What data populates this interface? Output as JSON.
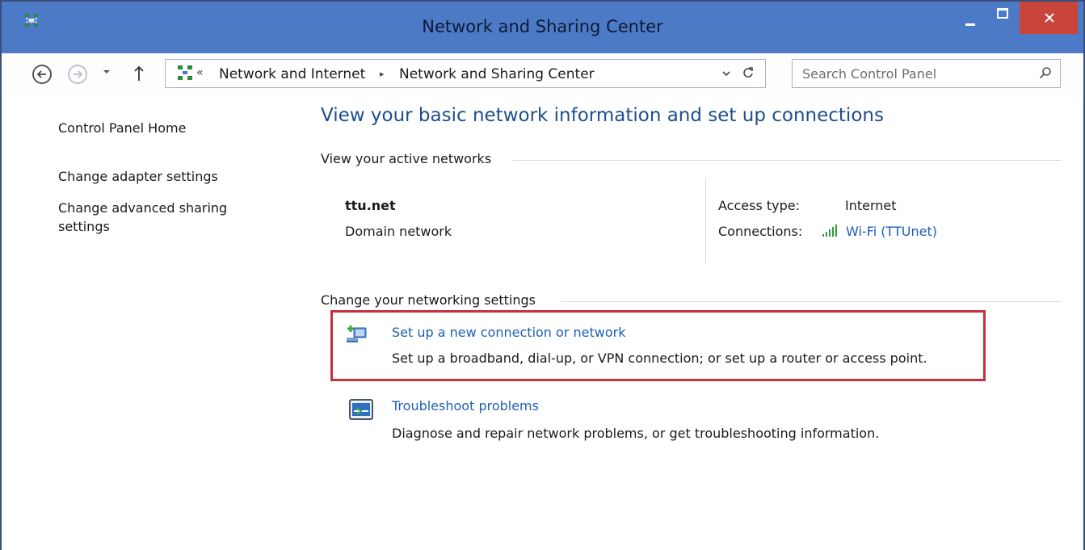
{
  "window": {
    "title": "Network and Sharing Center",
    "titlebar_color": "#4d7ac7",
    "close_color": "#c9443a"
  },
  "address_bar": {
    "overflow": "«",
    "crumbs": [
      "Network and Internet",
      "Network and Sharing Center"
    ],
    "separator": "▸"
  },
  "search": {
    "placeholder": "Search Control Panel"
  },
  "left_nav": {
    "items": [
      {
        "label": "Control Panel Home"
      },
      {
        "label": "Change adapter settings"
      },
      {
        "label": "Change advanced sharing settings"
      }
    ]
  },
  "main": {
    "heading": "View your basic network information and set up connections",
    "active_networks_label": "View your active networks",
    "network": {
      "name": "ttu.net",
      "category": "Domain network",
      "access_type_label": "Access type:",
      "access_type_value": "Internet",
      "connections_label": "Connections:",
      "connection_value": "Wi-Fi (TTUnet)"
    },
    "change_settings_label": "Change your networking settings",
    "tasks": [
      {
        "icon": "new-connection-icon",
        "title": "Set up a new connection or network",
        "description": "Set up a broadband, dial-up, or VPN connection; or set up a router or access point."
      },
      {
        "icon": "troubleshoot-icon",
        "title": "Troubleshoot problems",
        "description": "Diagnose and repair network problems, or get troubleshooting information."
      }
    ],
    "highlight_color": "#c4303b",
    "link_color": "#1e5fb3",
    "heading_color": "#1e4e8c"
  }
}
